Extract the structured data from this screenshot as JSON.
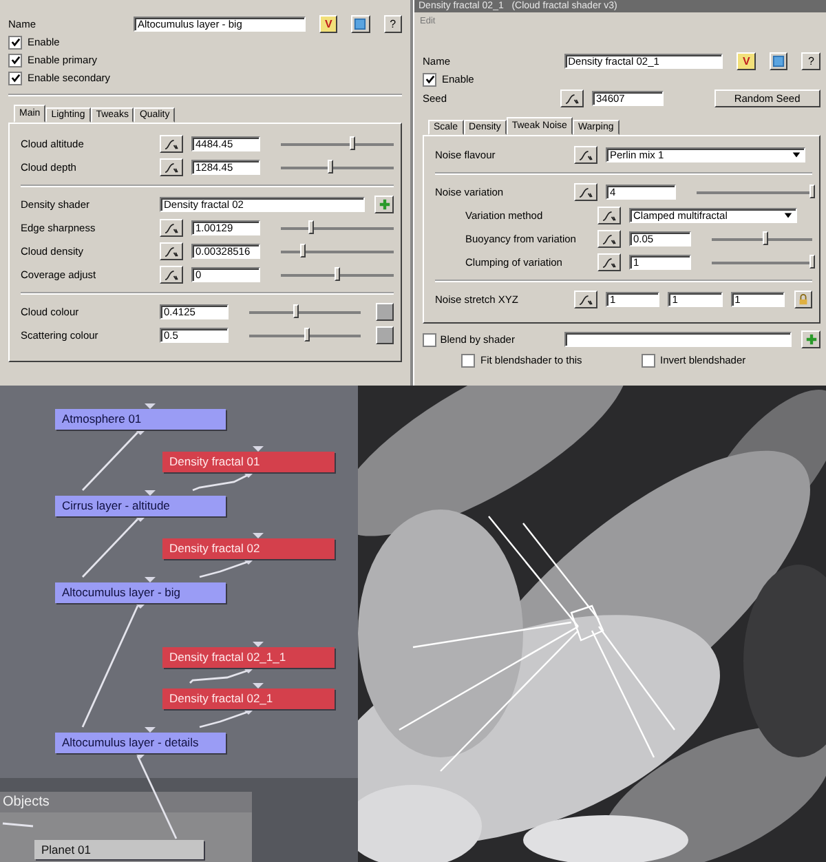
{
  "shader_panel": {
    "name_label": "Name",
    "name_value": "Altocumulus layer - big",
    "name_buttons": [
      "V",
      "?"
    ],
    "checkboxes": [
      {
        "label": "Enable",
        "checked": true
      },
      {
        "label": "Enable primary",
        "checked": true
      },
      {
        "label": "Enable secondary",
        "checked": true
      }
    ],
    "tabs": [
      {
        "label": "Main",
        "selected": true
      },
      {
        "label": "Lighting",
        "selected": false
      },
      {
        "label": "Tweaks",
        "selected": false
      },
      {
        "label": "Quality",
        "selected": false
      }
    ],
    "groups": [
      [
        {
          "kind": "slider",
          "label": "Cloud altitude",
          "value": "4484.45",
          "level": 0.63
        },
        {
          "kind": "slider",
          "label": "Cloud depth",
          "value": "1284.45",
          "level": 0.44
        }
      ],
      [
        {
          "kind": "shader",
          "label": "Density shader",
          "value": "Density fractal 02"
        },
        {
          "kind": "slider",
          "label": "Edge sharpness",
          "value": "1.00129",
          "level": 0.27
        },
        {
          "kind": "slider",
          "label": "Cloud density",
          "value": "0.00328516",
          "level": 0.19
        },
        {
          "kind": "slider",
          "label": "Coverage adjust",
          "value": "0",
          "level": 0.5
        }
      ],
      [
        {
          "kind": "colour",
          "label": "Cloud colour",
          "value": "0.4125",
          "level": 0.42
        },
        {
          "kind": "colour",
          "label": "Scattering colour",
          "value": "0.5",
          "level": 0.52
        }
      ]
    ]
  },
  "fractal_panel": {
    "title": "Density fractal 02_1   (Cloud fractal shader v3)",
    "menu": [
      "Edit"
    ],
    "name_label": "Name",
    "name_value": "Density fractal 02_1",
    "name_buttons": [
      "V",
      "?"
    ],
    "checkboxes": [
      {
        "label": "Enable",
        "checked": true
      }
    ],
    "seed_label": "Seed",
    "seed_value": "34607",
    "seed_button": "Random Seed",
    "tabs": [
      {
        "label": "Scale",
        "selected": false
      },
      {
        "label": "Density",
        "selected": false
      },
      {
        "label": "Tweak Noise",
        "selected": true
      },
      {
        "label": "Warping",
        "selected": false
      }
    ],
    "groups": [
      [
        {
          "kind": "dropdown",
          "label": "Noise flavour",
          "value": "Perlin mix 1"
        }
      ],
      [
        {
          "kind": "slider",
          "label": "Noise variation",
          "value": "4",
          "level": 1.0,
          "children": [
            {
              "kind": "dropdown",
              "label": "Variation method",
              "value": "Clamped multifractal"
            },
            {
              "kind": "slider",
              "label": "Buoyancy from variation",
              "value": "0.05",
              "level": 0.53
            },
            {
              "kind": "slider",
              "label": "Clumping of variation",
              "value": "1",
              "level": 1.0
            }
          ]
        }
      ],
      [
        {
          "kind": "vector",
          "label": "Noise stretch XYZ",
          "values": [
            "1",
            "1",
            "1"
          ]
        }
      ]
    ],
    "blend": {
      "label": "Blend by shader",
      "checked": false
    },
    "blend_options": [
      {
        "label": "Fit blendshader to this",
        "checked": false
      },
      {
        "label": "Invert blendshader",
        "checked": false
      }
    ]
  },
  "node_graph": {
    "nodes": [
      {
        "label": "Atmosphere 01",
        "color": "#9a9cf5"
      },
      {
        "label": "Density fractal 01",
        "color": "#d4404c"
      },
      {
        "label": "Cirrus layer - altitude",
        "color": "#9a9cf5"
      },
      {
        "label": "Density fractal 02",
        "color": "#d4404c"
      },
      {
        "label": "Altocumulus layer - big",
        "color": "#9a9cf5"
      },
      {
        "label": "Density fractal 02_1_1",
        "color": "#d4404c"
      },
      {
        "label": "Density fractal 02_1",
        "color": "#d4404c"
      },
      {
        "label": "Altocumulus layer - details",
        "color": "#9a9cf5"
      }
    ],
    "objects_panel": {
      "title": "Objects",
      "nodes": [
        {
          "label": "Planet 01"
        }
      ]
    }
  }
}
